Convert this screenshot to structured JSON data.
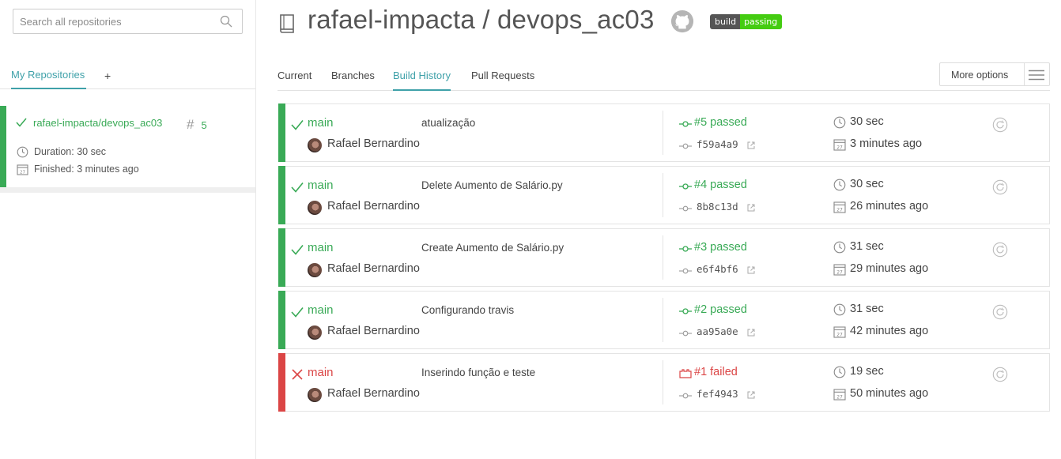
{
  "sidebar": {
    "search_placeholder": "Search all repositories",
    "tab_label": "My Repositories",
    "add_label": "+",
    "repo": {
      "name": "rafael-impacta/devops_ac03",
      "hash": "#",
      "number": "5",
      "duration": "Duration: 30 sec",
      "finished": "Finished: 3 minutes ago"
    }
  },
  "header": {
    "title": "rafael-impacta / devops_ac03",
    "badge_left": "build",
    "badge_right": "passing"
  },
  "tabs": [
    "Current",
    "Branches",
    "Build History",
    "Pull Requests"
  ],
  "active_tab": "Build History",
  "more_options": "More options",
  "builds": [
    {
      "status": "passed",
      "branch": "main",
      "message": "atualização",
      "author": "Rafael Bernardino",
      "number": "#5 passed",
      "commit": "f59a4a9",
      "duration": "30 sec",
      "finished": "3 minutes ago"
    },
    {
      "status": "passed",
      "branch": "main",
      "message": "Delete Aumento de Salário.py",
      "author": "Rafael Bernardino",
      "number": "#4 passed",
      "commit": "8b8c13d",
      "duration": "30 sec",
      "finished": "26 minutes ago"
    },
    {
      "status": "passed",
      "branch": "main",
      "message": "Create Aumento de Salário.py",
      "author": "Rafael Bernardino",
      "number": "#3 passed",
      "commit": "e6f4bf6",
      "duration": "31 sec",
      "finished": "29 minutes ago"
    },
    {
      "status": "passed",
      "branch": "main",
      "message": "Configurando travis",
      "author": "Rafael Bernardino",
      "number": "#2 passed",
      "commit": "aa95a0e",
      "duration": "31 sec",
      "finished": "42 minutes ago"
    },
    {
      "status": "failed",
      "branch": "main",
      "message": "Inserindo função e teste",
      "author": "Rafael Bernardino",
      "number": "#1 failed",
      "commit": "fef4943",
      "duration": "19 sec",
      "finished": "50 minutes ago"
    }
  ],
  "colors": {
    "passed": "#39aa56",
    "failed": "#db4545",
    "accent": "#3fa1a9"
  }
}
